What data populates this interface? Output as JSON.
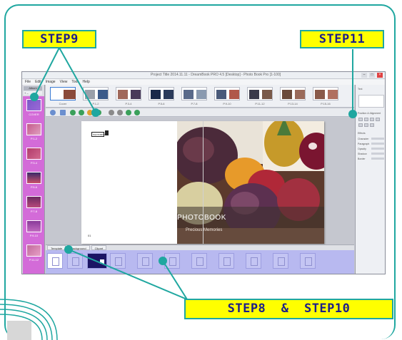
{
  "steps": {
    "step9": "STEP9",
    "step11": "STEP11",
    "step8_10": "STEP8  &  STEP10"
  },
  "window": {
    "title": "Project Title 2014.11.11 - DreamBook PRO 4.5 [Desktop] - Photo Book Pro [1-100]",
    "controls": [
      "–",
      "□",
      "×"
    ]
  },
  "menu": [
    "File",
    "Edit",
    "Image",
    "View",
    "Tool",
    "Help"
  ],
  "left_panel": {
    "tab": "Album",
    "control": "+ –",
    "thumb_labels": [
      "COVER",
      "P.1-2",
      "P.3-4",
      "P.5-6",
      "P.7-8",
      "P.9-10",
      "P.11-12"
    ]
  },
  "top_strip": {
    "labels": [
      "Cover",
      "P.1-2",
      "P.3-4",
      "P.5-6",
      "P.7-8",
      "P.9-10",
      "P.11-12",
      "P.13-14",
      "P.15-16"
    ]
  },
  "page": {
    "logo_text": "PHOTOBOOK",
    "page_number": "01"
  },
  "photo": {
    "title": "MY PHOTOBOOK",
    "subtitle": "Precious Memories"
  },
  "bottom_tabs": [
    "Template",
    "Background",
    "Clipart"
  ],
  "right_panel": {
    "header": "Text",
    "section1": "Position & Alignment",
    "section2": "Effects",
    "rows": [
      "Character",
      "Paragraph",
      "Opacity",
      "Shadow",
      "Border"
    ]
  },
  "colors": {
    "frame": "#1fa7a0",
    "step_bg": "#ffff00",
    "step_text": "#1c1e8a",
    "left_strip": "#d36bd8",
    "bottom_strip": "#b8b9f0"
  }
}
